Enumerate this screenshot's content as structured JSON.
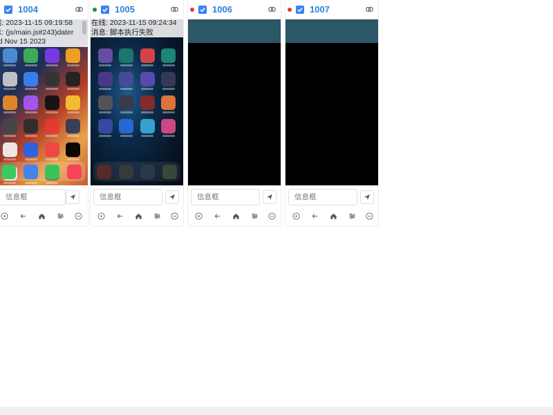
{
  "devices": [
    {
      "id": "1004",
      "info_lines": [
        "线: 2023-11-15 09:19:58",
        "息: (js/main.js#243)dater",
        "ed Nov 15 2023"
      ],
      "message_placeholder": "信息框",
      "status_color": "#4caf50"
    },
    {
      "id": "1005",
      "info_lines": [
        "在线: 2023-11-15 09:24:34",
        "消息: 脚本执行失败"
      ],
      "message_placeholder": "信息框",
      "status_color": "#1e8e3e"
    },
    {
      "id": "1006",
      "info_lines": [],
      "message_placeholder": "信息框",
      "status_color": "#e53935"
    },
    {
      "id": "1007",
      "info_lines": [],
      "message_placeholder": "信息框",
      "status_color": "#e53935"
    }
  ],
  "screen_caption": "",
  "icons": {
    "checkbox": "check-icon",
    "link": "link-icon",
    "send": "send-icon",
    "controls": [
      "play-circle-icon",
      "back-arrow-icon",
      "home-icon",
      "sliders-icon",
      "close-circle-icon"
    ]
  },
  "colors": {
    "accent": "#2b82d9",
    "checkbox": "#3b82f6",
    "teal_bar": "#2b5766"
  }
}
